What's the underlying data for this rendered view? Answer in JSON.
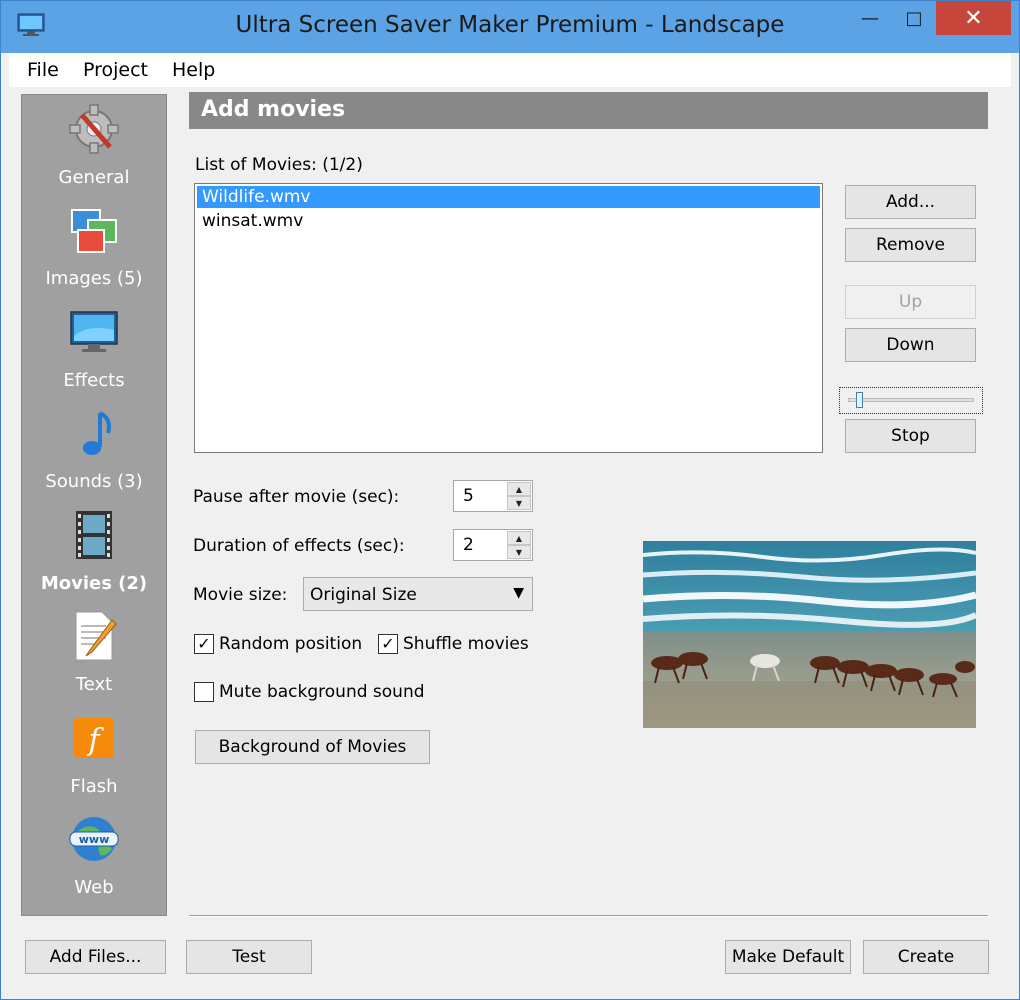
{
  "window": {
    "title": "Ultra Screen Saver Maker Premium - Landscape",
    "minimize_glyph": "—",
    "maximize_glyph": "□",
    "close_glyph": "✕"
  },
  "menu": [
    "File",
    "Project",
    "Help"
  ],
  "sidebar": {
    "items": [
      {
        "label": "General",
        "icon": "gear-icon",
        "active": false
      },
      {
        "label": "Images (5)",
        "icon": "images-icon",
        "active": false
      },
      {
        "label": "Effects",
        "icon": "monitor-icon",
        "active": false
      },
      {
        "label": "Sounds (3)",
        "icon": "music-note-icon",
        "active": false
      },
      {
        "label": "Movies (2)",
        "icon": "film-icon",
        "active": true
      },
      {
        "label": "Text",
        "icon": "text-document-icon",
        "active": false
      },
      {
        "label": "Flash",
        "icon": "flash-icon",
        "active": false
      },
      {
        "label": "Web",
        "icon": "globe-www-icon",
        "active": false
      }
    ]
  },
  "panel": {
    "header": "Add movies",
    "list_label": "List of Movies:",
    "list_count": "(1/2)",
    "movies": [
      {
        "name": "Wildlife.wmv",
        "selected": true
      },
      {
        "name": "winsat.wmv",
        "selected": false
      }
    ],
    "buttons": {
      "add": "Add...",
      "remove": "Remove",
      "up": "Up",
      "down": "Down",
      "stop": "Stop"
    },
    "pause_label": "Pause after movie (sec):",
    "pause_value": "5",
    "duration_label": "Duration of effects (sec):",
    "duration_value": "2",
    "movie_size_label": "Movie size:",
    "movie_size_value": "Original Size",
    "random_position_label": "Random position",
    "random_position_checked": true,
    "shuffle_label": "Shuffle movies",
    "shuffle_checked": true,
    "mute_label": "Mute background sound",
    "mute_checked": false,
    "background_button": "Background of Movies"
  },
  "footer": {
    "add_files": "Add Files...",
    "test": "Test",
    "make_default": "Make Default",
    "create": "Create"
  },
  "colors": {
    "titlebar": "#5ba3e4",
    "close": "#c7463c",
    "sidebar": "#a0a0a0",
    "header": "#888888",
    "selection": "#3399ff"
  }
}
